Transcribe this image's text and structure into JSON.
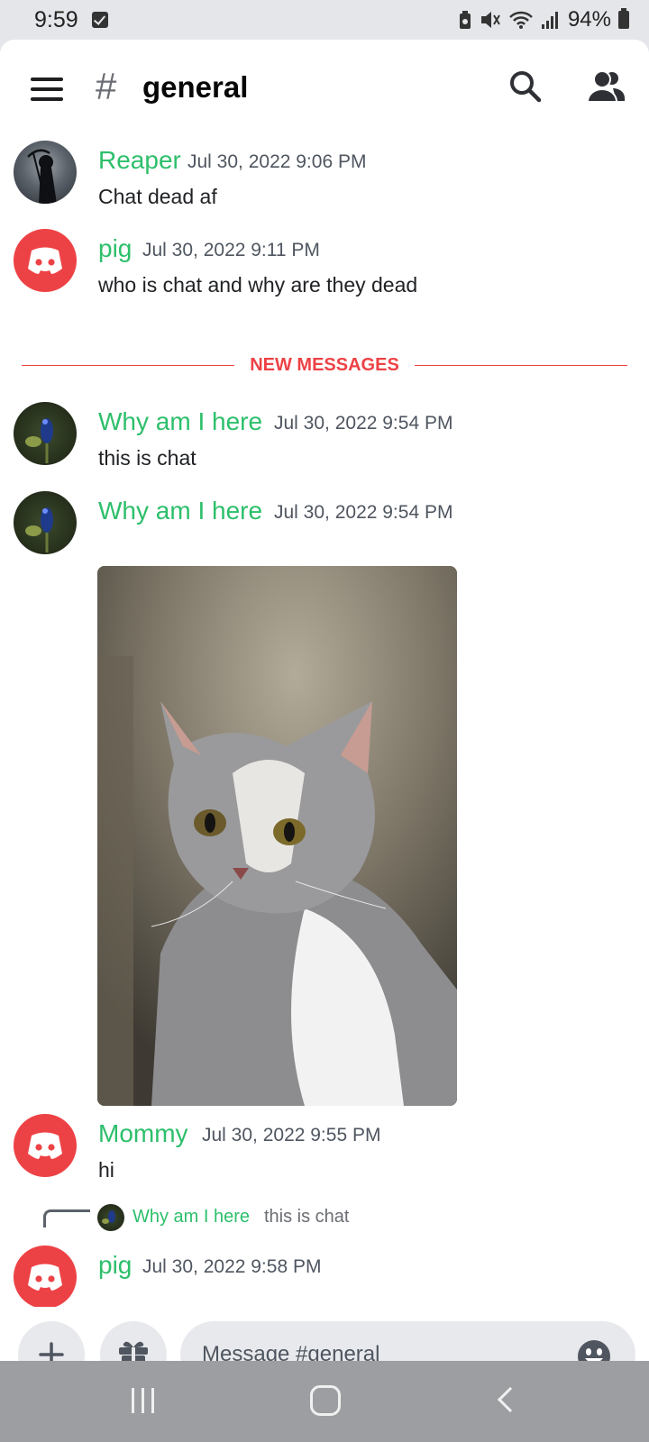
{
  "status_bar": {
    "time": "9:59",
    "battery": "94%",
    "icons": [
      "checkbox-icon",
      "battery-saver-icon",
      "mute-icon",
      "wifi-icon",
      "signal-icon",
      "battery-icon"
    ]
  },
  "header": {
    "channel_prefix": "#",
    "channel_name": "general",
    "icons": [
      "menu-icon",
      "search-icon",
      "members-icon"
    ]
  },
  "messages": [
    {
      "author": "Reaper",
      "timestamp": "Jul 30, 2022 9:06 PM",
      "text": "Chat dead af",
      "avatar": "reaper"
    },
    {
      "author": "pig",
      "timestamp": "Jul 30, 2022 9:11 PM",
      "text": "who is chat and why are they dead",
      "avatar": "discord"
    },
    {
      "author": "Why am I here",
      "timestamp": "Jul 30, 2022 9:54 PM",
      "text": "this is chat",
      "avatar": "plant"
    },
    {
      "author": "Why am I here",
      "timestamp": "Jul 30, 2022 9:54 PM",
      "text": "",
      "avatar": "plant",
      "attachment": "cat-photo"
    },
    {
      "author": "Mommy",
      "timestamp": "Jul 30, 2022 9:55 PM",
      "text": "hi",
      "avatar": "discord"
    },
    {
      "author": "pig",
      "timestamp": "Jul 30, 2022 9:58 PM",
      "text": "",
      "avatar": "discord",
      "reply_to": {
        "author": "Why am I here",
        "text": "this is chat"
      }
    }
  ],
  "divider": {
    "label": "NEW MESSAGES"
  },
  "composer": {
    "placeholder": "Message #general",
    "icons": [
      "plus-icon",
      "gift-icon",
      "emoji-icon"
    ]
  },
  "colors": {
    "author_green": "#2dbf6b",
    "new_messages_red": "#ed4245",
    "discord_avatar": "#ed4245"
  }
}
